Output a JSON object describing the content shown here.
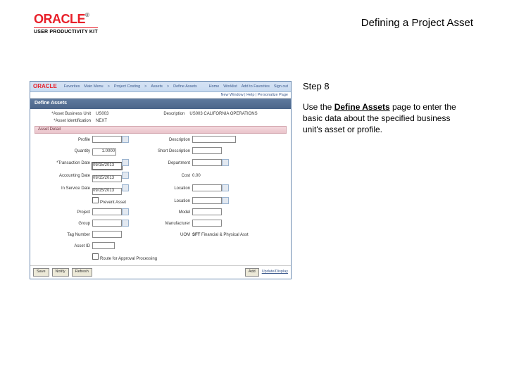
{
  "header": {
    "brand": "ORACLE",
    "product_line": "USER PRODUCTIVITY KIT",
    "doc_title": "Defining a Project Asset"
  },
  "instruction": {
    "step_label": "Step 8",
    "prefix": "Use the ",
    "page_name": "Define Assets",
    "suffix": " page to enter the basic data about the specified business unit's asset or profile."
  },
  "mini": {
    "nav": [
      "Favorites",
      "Main Menu",
      "Project Costing",
      "Assets",
      "Define Assets"
    ],
    "user_links": [
      "Home",
      "Worklist",
      "Add to Favorites",
      "Sign out"
    ],
    "subnav": "New Window | Help | Personalize Page",
    "tab_title": "Define Assets",
    "bu_label": "*Asset Business Unit",
    "bu_value": "US003",
    "desc_label": "Description",
    "desc_value": "US003 CALIFORNIA OPERATIONS",
    "asset_id_label": "*Asset Identification",
    "asset_id_value": "NEXT",
    "section": "Asset Detail",
    "fields": {
      "profile": "Profile",
      "description": "Description",
      "quantity": "Quantity",
      "quantity_val": "1.0000",
      "short_desc": "Short Description",
      "trans_date": "*Transaction Date",
      "trans_date_val": "09/15/2013",
      "department": "Department",
      "acct_date": "Accounting Date",
      "acct_date_val": "09/15/2013",
      "cost": "Cost",
      "cost_val": "0.00",
      "inservice": "In Service Date",
      "inservice_val": "09/15/2013",
      "location": "Location",
      "prevent_asset": "Prevent Asset",
      "location2": "Location",
      "project": "Project",
      "model": "Model",
      "group": "Group",
      "manufacturer": "Manufacturer",
      "tag": "Tag Number",
      "uom": "UOM",
      "uom_val": "SFT",
      "uom_text": "Financial & Physical Asst",
      "assetid2": "Asset ID",
      "route_approval": "Route for Approval Processing"
    },
    "footer": {
      "save": "Save",
      "notify": "Notify",
      "refresh": "Refresh",
      "add": "Add",
      "update": "Update/Display"
    }
  }
}
